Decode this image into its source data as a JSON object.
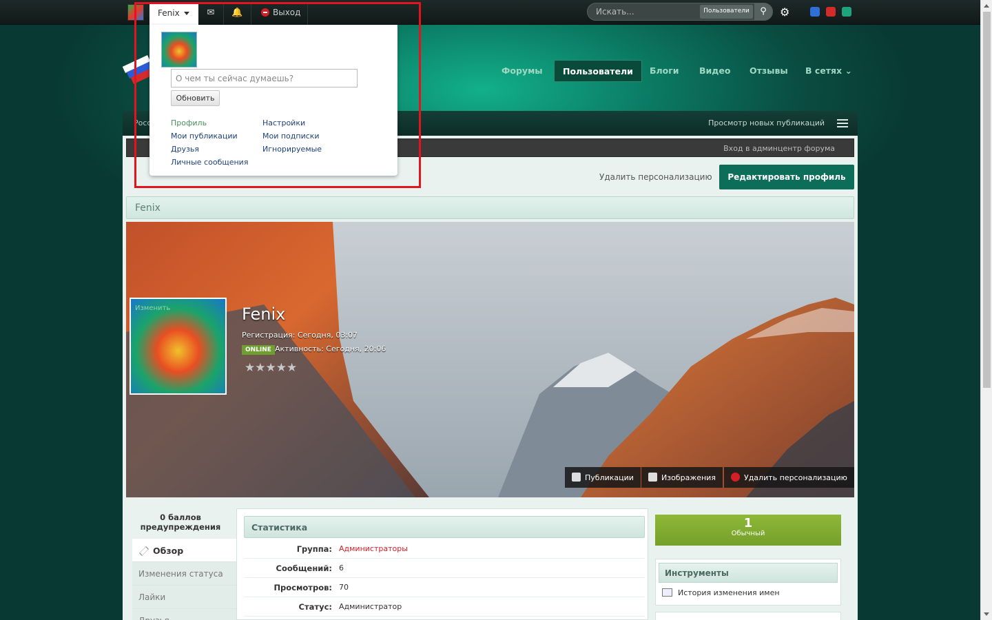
{
  "topbar": {
    "user_name": "Fenix",
    "logout_label": "Выход",
    "search_placeholder": "Искать...",
    "search_scope": "Пользователи",
    "swatch_colors": [
      "#2f6fd6",
      "#d32a2a",
      "#1fa37c"
    ]
  },
  "main_nav": {
    "items": [
      {
        "label": "Форумы"
      },
      {
        "label": "Пользователи",
        "active": true
      },
      {
        "label": "Блоги"
      },
      {
        "label": "Видео"
      },
      {
        "label": "Отзывы"
      },
      {
        "label": "В сетях"
      }
    ]
  },
  "breadcrumb": {
    "left": "Росс",
    "new_posts": "Просмотр новых публикаций",
    "admin_link": "Вход в админцентр форума"
  },
  "actions": {
    "remove_customization": "Удалить персонализацию",
    "edit_profile": "Редактировать профиль"
  },
  "profile": {
    "title_bar": "Fenix",
    "change_photo": "Изменить",
    "name": "Fenix",
    "registration": "Регистрация: Сегодня, 03:07",
    "online_badge": "ONLINE",
    "activity": "Активность: Сегодня, 20:06",
    "rating_stars": 0,
    "cover_buttons": {
      "publications": "Публикации",
      "images": "Изображения",
      "remove_customization": "Удалить персонализацию"
    }
  },
  "sidebar": {
    "warnings": "0 баллов предупреждения",
    "items": [
      {
        "label": "Обзор",
        "active": true
      },
      {
        "label": "Изменения статуса"
      },
      {
        "label": "Лайки"
      },
      {
        "label": "Друзья"
      }
    ]
  },
  "stats": {
    "title": "Статистика",
    "rows": [
      {
        "key": "Группа:",
        "value": "Администраторы"
      },
      {
        "key": "Сообщений:",
        "value": "6"
      },
      {
        "key": "Просмотров:",
        "value": "70"
      },
      {
        "key": "Статус:",
        "value": "Администратор"
      }
    ]
  },
  "rank": {
    "number": "1",
    "label": "Обычный"
  },
  "tools": {
    "title": "Инструменты",
    "link": "История изменения имен"
  },
  "dropdown": {
    "status_placeholder": "О чем ты сейчас думаешь?",
    "update_button": "Обновить",
    "links_left": [
      "Профиль",
      "Мои публикации",
      "Друзья",
      "Личные сообщения"
    ],
    "links_right": [
      "Настройки",
      "Мои подписки",
      "Игнорируемые"
    ]
  }
}
